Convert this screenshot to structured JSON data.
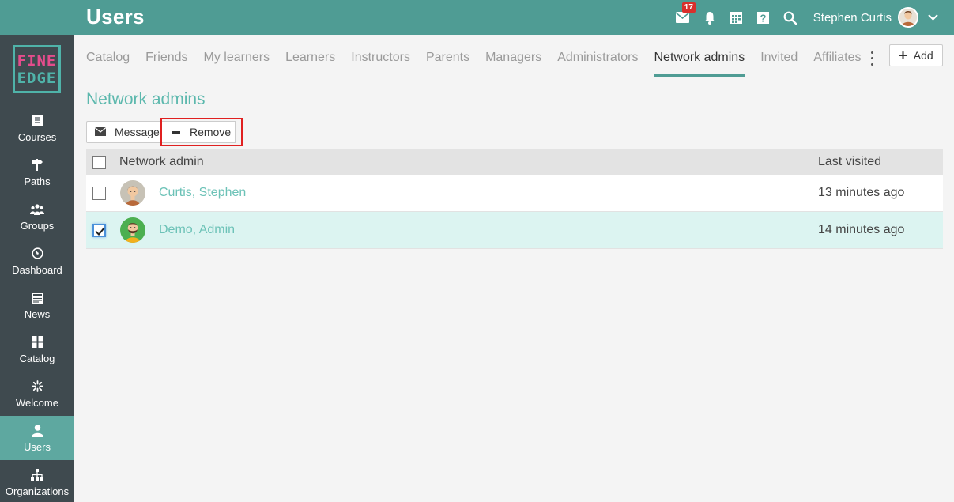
{
  "header": {
    "title": "Users",
    "mail_badge": "17",
    "user_name": "Stephen Curtis"
  },
  "logo": {
    "line1": "FINE",
    "line2": "EDGE"
  },
  "sidebar": {
    "items": [
      {
        "label": "Courses",
        "icon": "book-icon"
      },
      {
        "label": "Paths",
        "icon": "signpost-icon"
      },
      {
        "label": "Groups",
        "icon": "groups-icon"
      },
      {
        "label": "Dashboard",
        "icon": "gauge-icon"
      },
      {
        "label": "News",
        "icon": "newspaper-icon"
      },
      {
        "label": "Catalog",
        "icon": "grid-icon"
      },
      {
        "label": "Welcome",
        "icon": "sparkle-icon"
      },
      {
        "label": "Users",
        "icon": "user-icon",
        "active": true
      },
      {
        "label": "Organizations",
        "icon": "org-chart-icon"
      }
    ]
  },
  "tabs": [
    "Catalog",
    "Friends",
    "My learners",
    "Learners",
    "Instructors",
    "Parents",
    "Managers",
    "Administrators",
    "Network admins",
    "Invited",
    "Affiliates"
  ],
  "active_tab": "Network admins",
  "add_label": "Add",
  "page_title": "Network admins",
  "actions": {
    "message": "Message",
    "remove": "Remove"
  },
  "table": {
    "col_name": "Network admin",
    "col_last": "Last visited",
    "rows": [
      {
        "name": "Curtis, Stephen",
        "last": "13 minutes ago",
        "checked": false
      },
      {
        "name": "Demo, Admin",
        "last": "14 minutes ago",
        "checked": true
      }
    ]
  },
  "colors": {
    "topbar": "#4f9c94",
    "sidebar": "#3f4a4f",
    "accent": "#5cb8ad",
    "selected_row": "#dcf4f1",
    "highlight": "#e02020"
  }
}
